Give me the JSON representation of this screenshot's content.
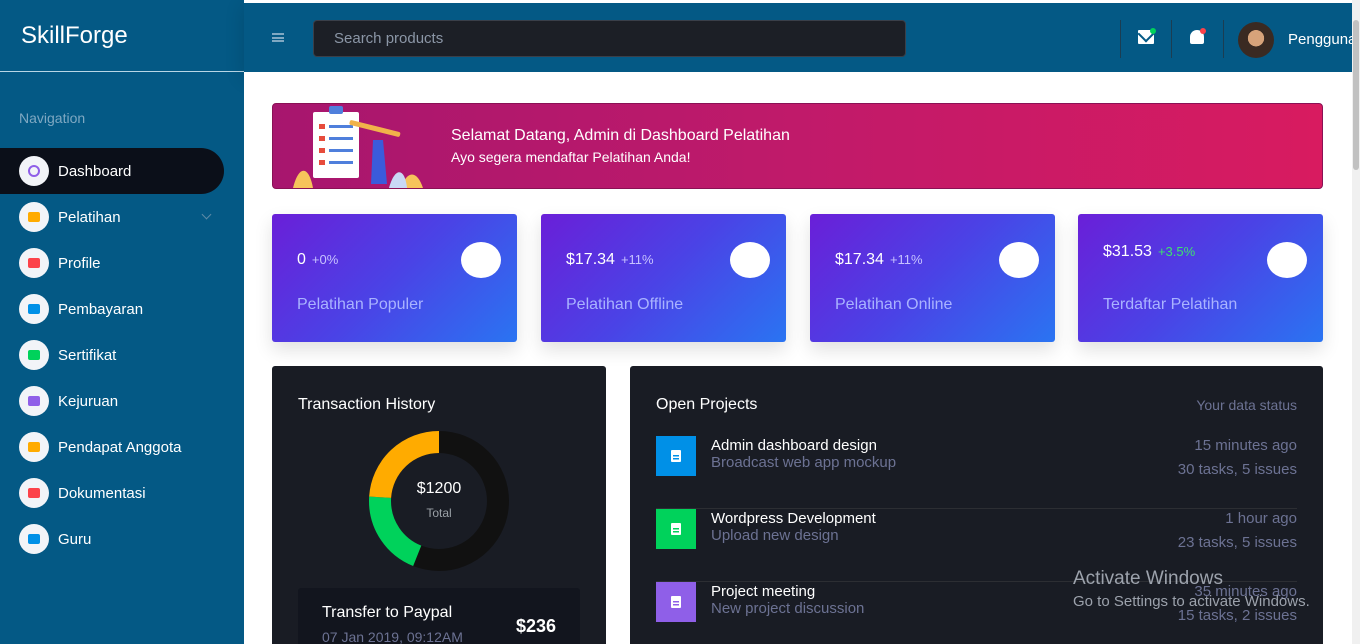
{
  "brand": {
    "name": "SkillForge"
  },
  "sidebar": {
    "heading": "Navigation",
    "items": [
      {
        "label": "Dashboard",
        "icon": "speedometer-icon",
        "color": "#8f5fe8",
        "active": true
      },
      {
        "label": "Pelatihan",
        "icon": "laptop-icon",
        "color": "#ffab00",
        "has_submenu": true
      },
      {
        "label": "Profile",
        "icon": "playlist-icon",
        "color": "#fc424a"
      },
      {
        "label": "Pembayaran",
        "icon": "table-icon",
        "color": "#0090e7"
      },
      {
        "label": "Sertifikat",
        "icon": "chart-bar-icon",
        "color": "#00d25b"
      },
      {
        "label": "Kejuruan",
        "icon": "contacts-icon",
        "color": "#8f5fe8"
      },
      {
        "label": "Pendapat Anggota",
        "icon": "note-icon",
        "color": "#ffab00"
      },
      {
        "label": "Dokumentasi",
        "icon": "document-icon",
        "color": "#fc424a"
      },
      {
        "label": "Guru",
        "icon": "document-box-icon",
        "color": "#0090e7"
      }
    ]
  },
  "topbar": {
    "search_placeholder": "Search products",
    "user_name": "Pengguna",
    "mail_dot_color": "#00d25b",
    "bell_dot_color": "#fc424a"
  },
  "banner": {
    "title": "Selamat Datang, Admin di Dashboard Pelatihan",
    "subtitle": "Ayo segera mendaftar Pelatihan Anda!"
  },
  "stats": [
    {
      "value": "0",
      "change": "+0%",
      "label": "Pelatihan Populer",
      "positive_color": false
    },
    {
      "value": "$17.34",
      "change": "+11%",
      "label": "Pelatihan Offline",
      "positive_color": false
    },
    {
      "value": "$17.34",
      "change": "+11%",
      "label": "Pelatihan Online",
      "positive_color": false
    },
    {
      "value": "$31.53",
      "change": "+3.5%",
      "label": "Terdaftar Pelatihan",
      "positive_color": true
    }
  ],
  "transactions": {
    "title": "Transaction History",
    "total_value": "$1200",
    "total_label": "Total",
    "donut_segments": [
      {
        "name": "dark",
        "fraction": 0.56,
        "color": "#111111"
      },
      {
        "name": "green",
        "fraction": 0.2,
        "color": "#00d25b"
      },
      {
        "name": "yellow",
        "fraction": 0.24,
        "color": "#ffab00"
      }
    ],
    "item": {
      "title": "Transfer to Paypal",
      "date": "07 Jan 2019, 09:12AM",
      "amount": "$236"
    }
  },
  "projects": {
    "title": "Open Projects",
    "status": "Your data status",
    "items": [
      {
        "name": "Admin dashboard design",
        "desc": "Broadcast web app mockup",
        "time": "15 minutes ago",
        "tasks": "30 tasks, 5 issues",
        "icon": "file-document-icon",
        "color": "#0090e7"
      },
      {
        "name": "Wordpress Development",
        "desc": "Upload new design",
        "time": "1 hour ago",
        "tasks": "23 tasks, 5 issues",
        "icon": "cloud-download-icon",
        "color": "#00d25b"
      },
      {
        "name": "Project meeting",
        "desc": "New project discussion",
        "time": "35 minutes ago",
        "tasks": "15 tasks, 2 issues",
        "icon": "clock-icon",
        "color": "#8f5fe8"
      }
    ]
  },
  "watermark": {
    "title": "Activate Windows",
    "subtitle": "Go to Settings to activate Windows."
  }
}
